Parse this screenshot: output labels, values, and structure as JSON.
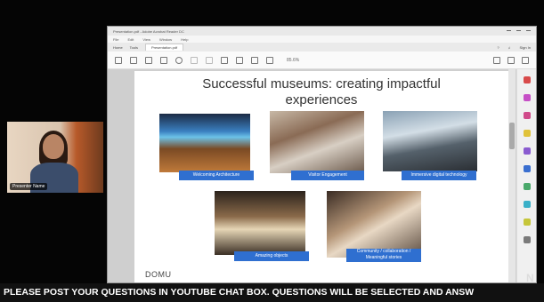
{
  "webcam": {
    "name_tag": "Presenter Name"
  },
  "window": {
    "title": "Presentation.pdf - Adobe Acrobat Reader DC",
    "menu": [
      "File",
      "Edit",
      "View",
      "Window",
      "Help"
    ],
    "tabs": [
      "Home",
      "Tools",
      "Presentation.pdf"
    ],
    "tabbar_right": "Sign In",
    "zoom": "85.6%"
  },
  "slide": {
    "title_line1": "Successful museums: creating impactful",
    "title_line2": "experiences",
    "captions": [
      "Welcoming Architecture",
      "Visitor Engagement",
      "Immersive digital technology",
      "Amazing objects",
      "Community / collaboration / Meaningful stories"
    ],
    "logo_text": "DOMU"
  },
  "ticker": "PLEASE POST YOUR QUESTIONS IN YOUTUBE CHAT BOX. QUESTIONS WILL BE SELECTED AND ANSW",
  "colors": {
    "caption_blue": "#2f6fd0",
    "ticker_bg": "#111111"
  }
}
